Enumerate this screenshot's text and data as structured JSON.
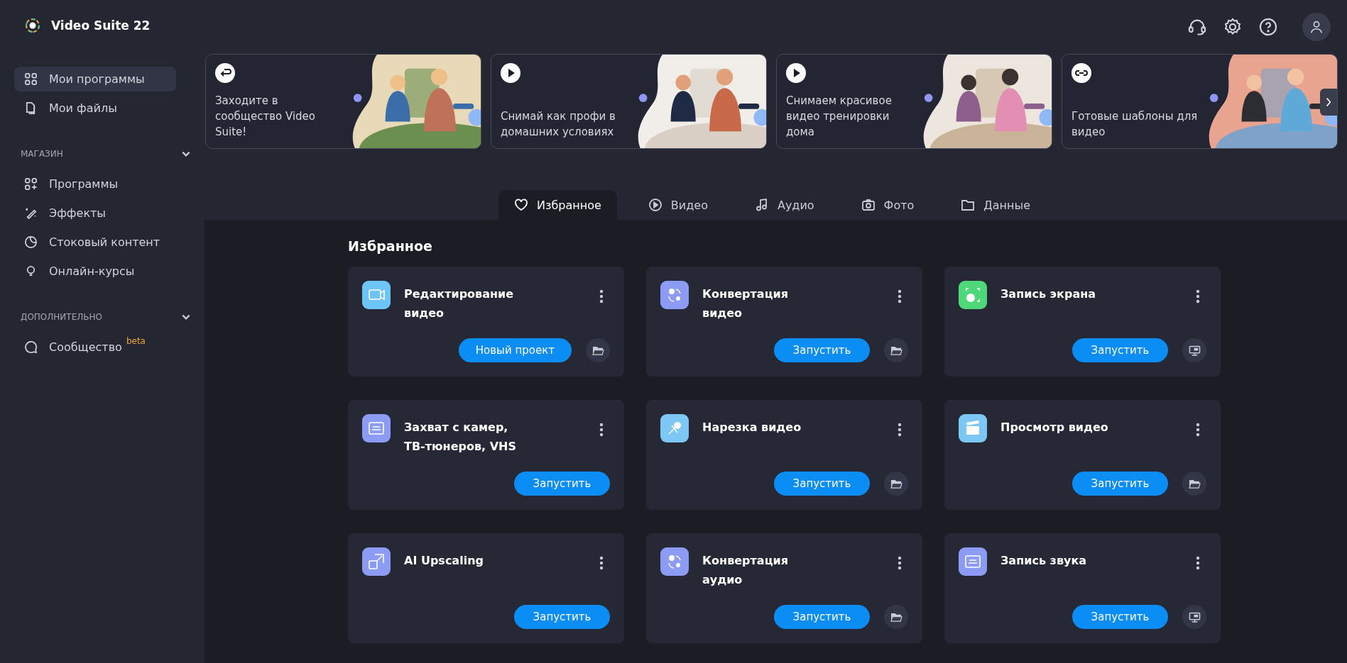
{
  "app": {
    "title": "Video Suite 22"
  },
  "sidebar": {
    "items": [
      {
        "label": "Мои программы",
        "selected": true
      },
      {
        "label": "Мои файлы",
        "selected": false
      }
    ],
    "sections": [
      {
        "title": "МАГАЗИН",
        "expanded": true,
        "items": [
          {
            "label": "Программы",
            "selected": false
          },
          {
            "label": "Эффекты",
            "selected": false
          },
          {
            "label": "Стоковый контент",
            "selected": false
          },
          {
            "label": "Онлайн-курсы",
            "selected": false
          }
        ]
      },
      {
        "title": "ДОПОЛНИТЕЛЬНО",
        "expanded": true,
        "items": [
          {
            "label": "Сообщество",
            "badge": "beta",
            "selected": false
          }
        ]
      }
    ]
  },
  "banners": [
    {
      "text": "Заходите в\nсообщество Video\nSuite!"
    },
    {
      "text": "Снимай как профи в\nдомашних условиях"
    },
    {
      "text": "Снимаем красивое\nвидео тренировки\nдома"
    },
    {
      "text": "Готовые шаблоны для\nвидео"
    }
  ],
  "tabs": [
    {
      "label": "Избранное",
      "selected": true
    },
    {
      "label": "Видео",
      "selected": false
    },
    {
      "label": "Аудио",
      "selected": false
    },
    {
      "label": "Фото",
      "selected": false
    },
    {
      "label": "Данные",
      "selected": false
    }
  ],
  "favorites": {
    "heading": "Избранное",
    "cards": [
      {
        "title": "Редактирование\nвидео",
        "color": "#6cc4f7",
        "action": "Новый проект",
        "secondary_button": {
          "kind": "folder"
        }
      },
      {
        "title": "Конвертация\nвидео",
        "color": "#8c9cf5",
        "action": "Запустить",
        "secondary_button": {
          "kind": "folder"
        }
      },
      {
        "title": "Запись экрана",
        "color": "#4fd87a",
        "action": "Запустить",
        "secondary_button": {
          "kind": "monitor"
        }
      },
      {
        "title": "Захват с камер,\nТВ-тюнеров, VHS",
        "color": "#8c9cf5",
        "action": "Запустить"
      },
      {
        "title": "Нарезка видео",
        "color": "#7cc7f3",
        "action": "Запустить",
        "secondary_button": {
          "kind": "folder"
        }
      },
      {
        "title": "Просмотр видео",
        "color": "#7cc7f3",
        "action": "Запустить",
        "secondary_button": {
          "kind": "folder"
        }
      },
      {
        "title": "AI Upscaling",
        "color": "#8c9cf5",
        "action": "Запустить"
      },
      {
        "title": "Конвертация\nаудио",
        "color": "#8c9cf5",
        "action": "Запустить",
        "secondary_button": {
          "kind": "folder"
        }
      },
      {
        "title": "Запись звука",
        "color": "#8c9cf5",
        "action": "Запустить",
        "secondary_button": {
          "kind": "monitor"
        }
      }
    ]
  }
}
